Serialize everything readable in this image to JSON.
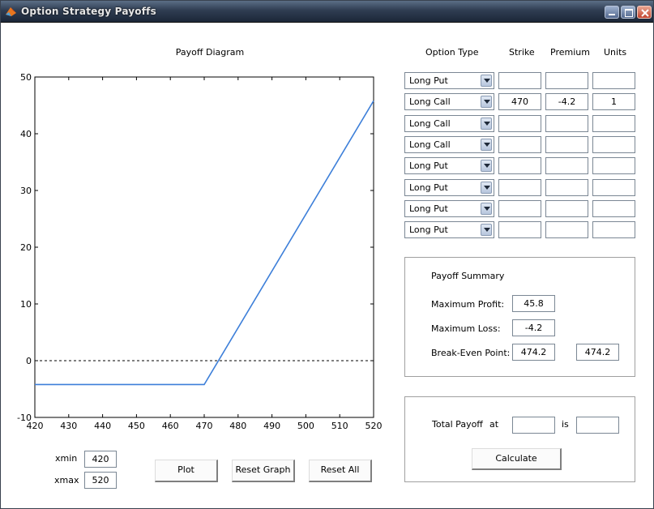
{
  "window": {
    "title": "Option Strategy Payoffs"
  },
  "plot": {
    "title": "Payoff Diagram",
    "chart_data": {
      "type": "line",
      "title": "Payoff Diagram",
      "xlabel": "",
      "ylabel": "",
      "xlim": [
        420,
        520
      ],
      "ylim": [
        -10,
        50
      ],
      "x_ticks": [
        420,
        430,
        440,
        450,
        460,
        470,
        480,
        490,
        500,
        510,
        520
      ],
      "y_ticks": [
        -10,
        0,
        10,
        20,
        30,
        40,
        50
      ],
      "series": [
        {
          "x": [
            420,
            470,
            520
          ],
          "y": [
            -4.2,
            -4.2,
            45.8
          ],
          "color": "#3d7fd9",
          "style": "solid"
        }
      ],
      "reference_lines": [
        {
          "y": 0,
          "style": "dashed",
          "color": "#000000"
        }
      ]
    }
  },
  "headers": {
    "option_type": "Option Type",
    "strike": "Strike",
    "premium": "Premium",
    "units": "Units"
  },
  "rows": [
    {
      "type": "Long Put",
      "strike": "",
      "premium": "",
      "units": ""
    },
    {
      "type": "Long Call",
      "strike": "470",
      "premium": "-4.2",
      "units": "1"
    },
    {
      "type": "Long Call",
      "strike": "",
      "premium": "",
      "units": ""
    },
    {
      "type": "Long Call",
      "strike": "",
      "premium": "",
      "units": ""
    },
    {
      "type": "Long Put",
      "strike": "",
      "premium": "",
      "units": ""
    },
    {
      "type": "Long Put",
      "strike": "",
      "premium": "",
      "units": ""
    },
    {
      "type": "Long Put",
      "strike": "",
      "premium": "",
      "units": ""
    },
    {
      "type": "Long Put",
      "strike": "",
      "premium": "",
      "units": ""
    }
  ],
  "summary": {
    "title": "Payoff Summary",
    "max_profit_label": "Maximum Profit:",
    "max_profit": "45.8",
    "max_loss_label": "Maximum Loss:",
    "max_loss": "-4.2",
    "breakeven_label": "Break-Even Point:",
    "breakeven_1": "474.2",
    "breakeven_2": "474.2"
  },
  "total": {
    "label": "Total Payoff",
    "at_label": "at",
    "is_label": "is",
    "at_value": "",
    "is_value": "",
    "calculate": "Calculate"
  },
  "range": {
    "xmin_label": "xmin",
    "xmin": "420",
    "xmax_label": "xmax",
    "xmax": "520"
  },
  "buttons": {
    "plot": "Plot",
    "reset_graph": "Reset Graph",
    "reset_all": "Reset All"
  }
}
